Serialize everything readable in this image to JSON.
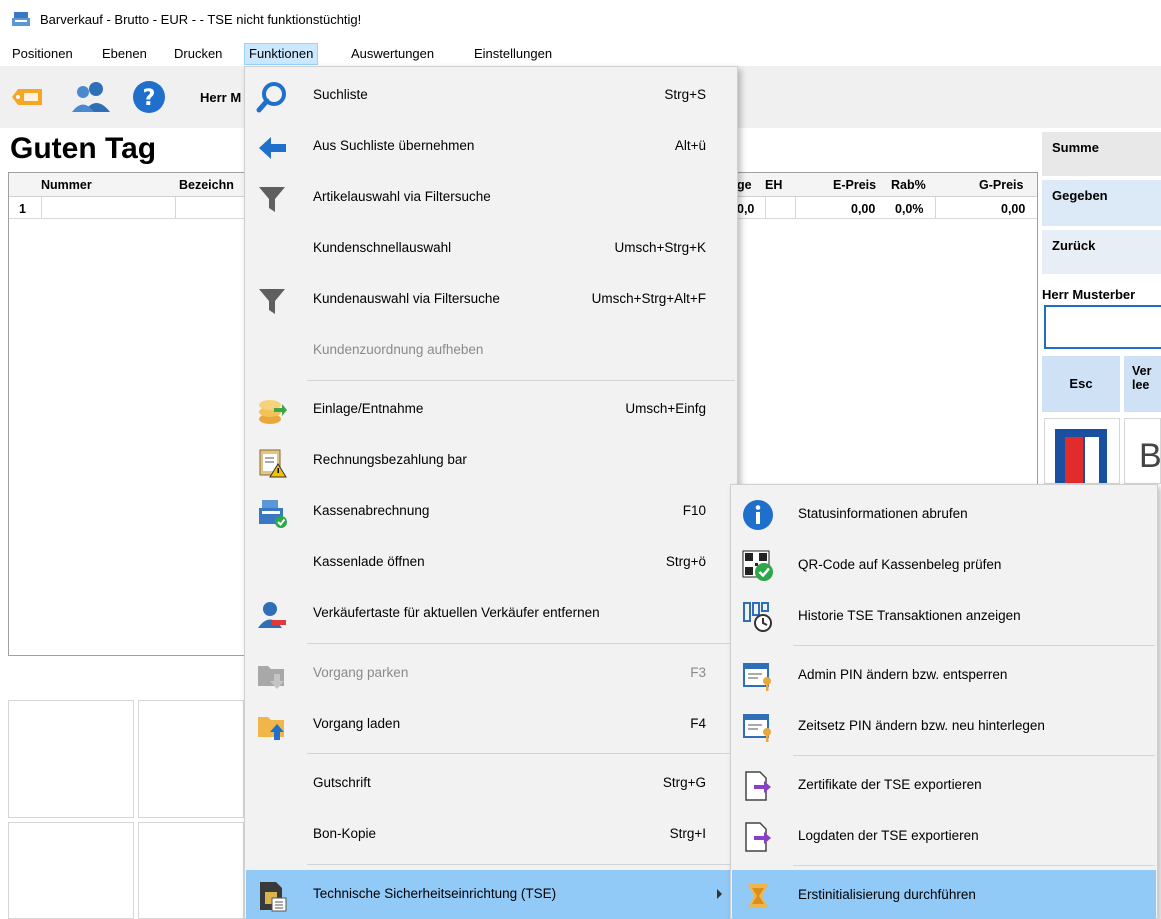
{
  "window": {
    "title": "Barverkauf - Brutto - EUR -  - TSE nicht funktionstüchtig!"
  },
  "menubar": {
    "items": [
      "Positionen",
      "Ebenen",
      "Drucken",
      "Funktionen",
      "Auswertungen",
      "Einstellungen"
    ],
    "active": "Funktionen"
  },
  "toolbar": {
    "customer_partial": "Herr M"
  },
  "greeting": "Guten Tag",
  "grid": {
    "headers": [
      "Nummer",
      "Bezeichn",
      "ge",
      "EH",
      "E-Preis",
      "Rab%",
      "G-Preis"
    ],
    "rows": [
      {
        "pos": "1",
        "menge": "0,0",
        "epreis": "0,00",
        "rabatt": "0,0%",
        "gpreis": "0,00"
      }
    ]
  },
  "right_panel": {
    "summe": "Summe",
    "gegeben": "Gegeben",
    "zurueck": "Zurück",
    "customer": "Herr Musterber",
    "esc": "Esc",
    "ver_line1": "Ver",
    "ver_line2": "lee",
    "payment_letter": "B"
  },
  "menu": {
    "items": [
      {
        "label": "Suchliste",
        "shortcut": "Strg+S",
        "icon": "magnifier-icon"
      },
      {
        "label": "Aus Suchliste übernehmen",
        "shortcut": "Alt+ü",
        "icon": "arrow-left-icon"
      },
      {
        "label": "Artikelauswahl via Filtersuche",
        "shortcut": "",
        "icon": "filter-icon"
      },
      {
        "label": "Kundenschnellauswahl",
        "shortcut": "Umsch+Strg+K",
        "icon": ""
      },
      {
        "label": "Kundenauswahl via Filtersuche",
        "shortcut": "Umsch+Strg+Alt+F",
        "icon": "filter-icon"
      },
      {
        "label": "Kundenzuordnung aufheben",
        "shortcut": "",
        "icon": "",
        "disabled": true
      },
      {
        "label": "Einlage/Entnahme",
        "shortcut": "Umsch+Einfg",
        "icon": "coins-icon"
      },
      {
        "label": "Rechnungsbezahlung bar",
        "shortcut": "",
        "icon": "clipboard-warning-icon"
      },
      {
        "label": "Kassenabrechnung",
        "shortcut": "F10",
        "icon": "register-check-icon"
      },
      {
        "label": "Kassenlade öffnen",
        "shortcut": "Strg+ö",
        "icon": ""
      },
      {
        "label": "Verkäufertaste für aktuellen Verkäufer entfernen",
        "shortcut": "",
        "icon": "user-remove-icon"
      },
      {
        "label": "Vorgang parken",
        "shortcut": "F3",
        "icon": "folder-down-icon",
        "disabled": true
      },
      {
        "label": "Vorgang laden",
        "shortcut": "F4",
        "icon": "folder-up-icon"
      },
      {
        "label": "Gutschrift",
        "shortcut": "Strg+G",
        "icon": ""
      },
      {
        "label": "Bon-Kopie",
        "shortcut": "Strg+I",
        "icon": ""
      },
      {
        "label": "Technische Sicherheitseinrichtung (TSE)",
        "shortcut": "",
        "icon": "sim-card-icon",
        "submenu": true
      }
    ]
  },
  "submenu": {
    "items": [
      {
        "label": "Statusinformationen abrufen",
        "icon": "info-icon"
      },
      {
        "label": "QR-Code auf Kassenbeleg prüfen",
        "icon": "qr-check-icon"
      },
      {
        "label": "Historie TSE Transaktionen anzeigen",
        "icon": "history-icon"
      },
      {
        "label": "Admin PIN ändern bzw. entsperren",
        "icon": "pin-key-icon"
      },
      {
        "label": "Zeitsetz PIN ändern bzw. neu hinterlegen",
        "icon": "pin-key-icon"
      },
      {
        "label": "Zertifikate der TSE exportieren",
        "icon": "export-icon"
      },
      {
        "label": "Logdaten der TSE exportieren",
        "icon": "export-icon"
      },
      {
        "label": "Erstinitialisierung durchführen",
        "icon": "wand-icon"
      }
    ]
  },
  "colors": {
    "highlight": "#91c9f7",
    "menu_bg": "#f2f2f2",
    "accent_blue": "#1e6ec8"
  }
}
